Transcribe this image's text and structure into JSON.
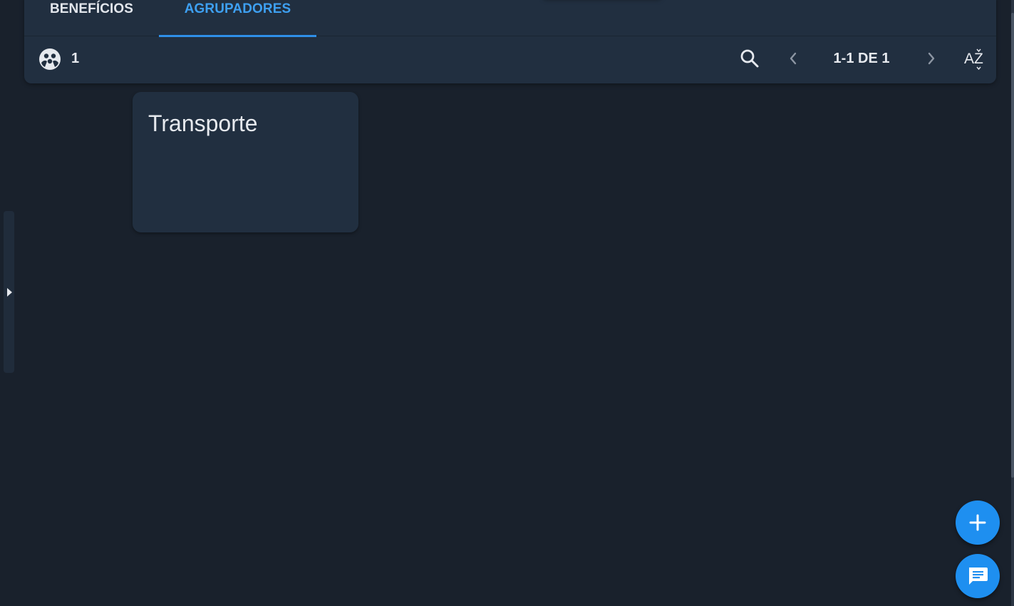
{
  "tabs": [
    {
      "label": "BENEFÍCIOS",
      "active": false
    },
    {
      "label": "AGRUPADORES",
      "active": true
    }
  ],
  "toolbar": {
    "count": "1",
    "count_icon": "group-icon",
    "search_icon": "search-icon",
    "prev_icon": "chevron-left-icon",
    "pagination": "1-1 DE 1",
    "next_icon": "chevron-right-icon",
    "sort_label": "AZ",
    "sort_icon": "sort-alpha-icon"
  },
  "cards": [
    {
      "title": "Transporte"
    }
  ],
  "fabs": {
    "add_icon": "plus-icon",
    "chat_icon": "chat-icon"
  },
  "colors": {
    "background": "#19212c",
    "panel": "#212f40",
    "accent": "#1e8ff0",
    "active_tab": "#3ea0f2",
    "text": "#e6e9ee"
  }
}
